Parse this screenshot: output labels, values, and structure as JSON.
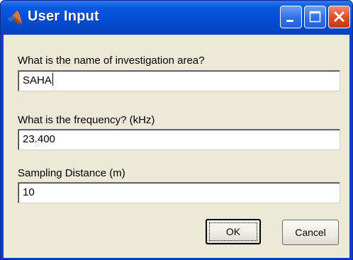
{
  "window": {
    "title": "User Input"
  },
  "fields": [
    {
      "label": "What is the name of investigation area?",
      "value": "SAHA"
    },
    {
      "label": "What is the frequency? (kHz)",
      "value": "23.400"
    },
    {
      "label": "Sampling Distance (m)",
      "value": "10"
    }
  ],
  "buttons": {
    "ok_label": "OK",
    "cancel_label": "Cancel"
  },
  "icons": {
    "app": "matlab-logo-icon",
    "minimize": "minimize-icon",
    "maximize": "maximize-icon",
    "close": "close-icon"
  },
  "colors": {
    "titlebar": "#0450d9",
    "close_button": "#dd4a22",
    "dialog_background": "#ece9d8"
  }
}
